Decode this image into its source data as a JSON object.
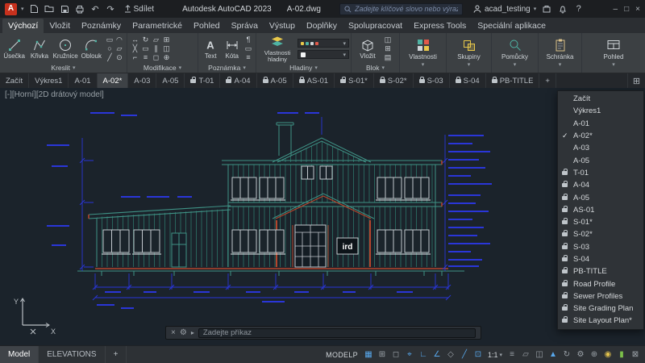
{
  "titlebar": {
    "logo": "A",
    "share": "Sdílet",
    "app_title": "Autodesk AutoCAD 2023",
    "file_name": "A-02.dwg",
    "search_placeholder": "Zadejte klíčové slovo nebo výraz",
    "account": "acad_testing"
  },
  "menubar": [
    {
      "label": "Výchozí",
      "active": true
    },
    {
      "label": "Vložit"
    },
    {
      "label": "Poznámky"
    },
    {
      "label": "Parametrické"
    },
    {
      "label": "Pohled"
    },
    {
      "label": "Správa"
    },
    {
      "label": "Výstup"
    },
    {
      "label": "Doplňky"
    },
    {
      "label": "Spolupracovat"
    },
    {
      "label": "Express Tools"
    },
    {
      "label": "Speciální aplikace"
    }
  ],
  "ribbon": {
    "draw_tools": [
      "Úsečka",
      "Křivka",
      "Kružnice",
      "Oblouk"
    ],
    "draw_mini": [
      "▭",
      "◠",
      "○",
      "▱",
      "╱",
      "⊙"
    ],
    "modify_mini": [
      "↔",
      "↻",
      "▱",
      "⊞",
      "╳",
      "▭",
      "∥",
      "◫",
      "⌐",
      "≡",
      "◻",
      "⊕"
    ],
    "annotate_tools": [
      "Text",
      "Kóta"
    ],
    "annotate_mini": [
      "¶",
      "▭",
      "≡"
    ],
    "layers_tool": "Vlastnosti hladiny",
    "block_tool": "Vložit",
    "block_mini": [
      "◫",
      "⊞",
      "▤"
    ],
    "panel_labels": [
      "Kreslit",
      "Modifikace",
      "Poznámka",
      "Hladiny",
      "Blok"
    ],
    "collapsed_panels": [
      "Vlastnosti",
      "Skupiny",
      "Pomůcky",
      "Schránka",
      "Pohled"
    ]
  },
  "file_tabs": [
    {
      "label": "Začít"
    },
    {
      "label": "Výkres1"
    },
    {
      "label": "A-01"
    },
    {
      "label": "A-02*",
      "active": true
    },
    {
      "label": "A-03"
    },
    {
      "label": "A-05"
    },
    {
      "label": "T-01",
      "locked": true
    },
    {
      "label": "A-04",
      "locked": true
    },
    {
      "label": "A-05",
      "locked": true
    },
    {
      "label": "AS-01",
      "locked": true
    },
    {
      "label": "S-01*",
      "locked": true
    },
    {
      "label": "S-02*",
      "locked": true
    },
    {
      "label": "S-03",
      "locked": true
    },
    {
      "label": "S-04",
      "locked": true
    },
    {
      "label": "PB-TITLE",
      "locked": true
    },
    {
      "label": "+",
      "add": true
    }
  ],
  "tab_menu": [
    {
      "label": "Začít"
    },
    {
      "label": "Výkres1"
    },
    {
      "label": "A-01"
    },
    {
      "label": "A-02*",
      "checked": true
    },
    {
      "label": "A-03"
    },
    {
      "label": "A-05"
    },
    {
      "label": "T-01",
      "locked": true
    },
    {
      "label": "A-04",
      "locked": true
    },
    {
      "label": "A-05",
      "locked": true
    },
    {
      "label": "AS-01",
      "locked": true
    },
    {
      "label": "S-01*",
      "locked": true
    },
    {
      "label": "S-02*",
      "locked": true
    },
    {
      "label": "S-03",
      "locked": true
    },
    {
      "label": "S-04",
      "locked": true
    },
    {
      "label": "PB-TITLE",
      "locked": true
    },
    {
      "label": "Road Profile",
      "locked": true
    },
    {
      "label": "Sewer Profiles",
      "locked": true
    },
    {
      "label": "Site Grading Plan",
      "locked": true
    },
    {
      "label": "Site Layout Plan*",
      "locked": true
    }
  ],
  "viewport_label": "[-][Horní][2D drátový model]",
  "command": {
    "placeholder": "Zadejte příkaz"
  },
  "statusbar": {
    "layout_tabs": [
      {
        "label": "Model",
        "active": true
      },
      {
        "label": "ELEVATIONS"
      },
      {
        "label": "+",
        "add": true
      }
    ],
    "model_space": "MODELP",
    "scale": "1:1",
    "icons_a": [
      {
        "name": "grid",
        "glyph": "▦",
        "on": true
      },
      {
        "name": "snap-mode",
        "glyph": "⊞"
      },
      {
        "name": "infer-constraints",
        "glyph": "◻"
      },
      {
        "name": "dynamic-input",
        "glyph": "⌖",
        "on": true
      },
      {
        "name": "ortho-mode",
        "glyph": "∟",
        "on": true
      },
      {
        "name": "polar-tracking",
        "glyph": "∠",
        "on": true
      },
      {
        "name": "isometric-drafting",
        "glyph": "◇"
      },
      {
        "name": "osnap-tracking",
        "glyph": "╱",
        "on": true
      },
      {
        "name": "object-snap",
        "glyph": "⊡",
        "on": true
      }
    ],
    "icons_b": [
      {
        "name": "lineweight",
        "glyph": "≡"
      },
      {
        "name": "transparency",
        "glyph": "▱"
      },
      {
        "name": "selection-cycling",
        "glyph": "◫"
      },
      {
        "name": "annotation-visibility",
        "glyph": "▲",
        "on": true
      },
      {
        "name": "autoscale",
        "glyph": "↻"
      },
      {
        "name": "workspace-settings",
        "glyph": "⚙"
      },
      {
        "name": "annotation-monitor",
        "glyph": "⊕"
      },
      {
        "name": "object-isolate",
        "glyph": "◉",
        "cls": "yellow"
      },
      {
        "name": "graphics-performance",
        "glyph": "▮",
        "cls": "green"
      },
      {
        "name": "clean-screen",
        "glyph": "⊠"
      }
    ]
  },
  "drawing": {
    "sign": "ird",
    "ucs_x": "X",
    "ucs_y": "Y"
  }
}
